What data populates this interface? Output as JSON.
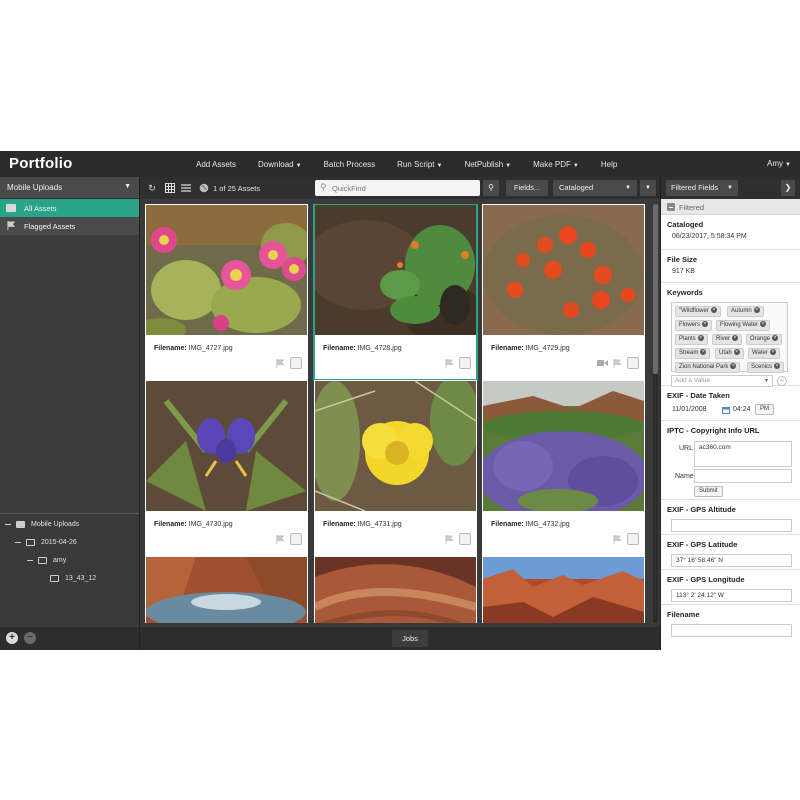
{
  "topbar": {
    "logo": "Portfolio",
    "nav": [
      {
        "label": "Add Assets",
        "caret": false
      },
      {
        "label": "Download",
        "caret": true
      },
      {
        "label": "Batch Process",
        "caret": false
      },
      {
        "label": "Run Script",
        "caret": true
      },
      {
        "label": "NetPublish",
        "caret": true
      },
      {
        "label": "Make PDF",
        "caret": true
      },
      {
        "label": "Help",
        "caret": false
      }
    ],
    "user": "Amy"
  },
  "left": {
    "dropdown": "Mobile Uploads",
    "items": [
      {
        "label": "All Assets",
        "selected": true
      },
      {
        "label": "Flagged Assets",
        "selected": false
      }
    ],
    "tree": [
      {
        "label": "Mobile Uploads"
      },
      {
        "label": "2015-04-26"
      },
      {
        "label": "amy"
      },
      {
        "label": "13_43_12"
      }
    ]
  },
  "toolbar": {
    "count": "1 of 25 Assets",
    "search_placeholder": "QuickFind",
    "fields_label": "Fields...",
    "sort_label": "Cataloged"
  },
  "grid": {
    "filename_label": "Filename:",
    "cards": [
      {
        "filename": "IMG_4727.jpg",
        "selected": false,
        "video": false,
        "image": "cactus-pink-flowers"
      },
      {
        "filename": "IMG_4728.jpg",
        "selected": true,
        "video": false,
        "image": "water-orange-flowers"
      },
      {
        "filename": "IMG_4729.jpg",
        "selected": false,
        "video": true,
        "image": "red-paintbrush-flowers"
      },
      {
        "filename": "IMG_4730.jpg",
        "selected": false,
        "video": false,
        "image": "purple-flower"
      },
      {
        "filename": "IMG_4731.jpg",
        "selected": false,
        "video": false,
        "image": "yellow-cactus-flower"
      },
      {
        "filename": "IMG_4732.jpg",
        "selected": false,
        "video": false,
        "image": "purple-lupine-field"
      },
      {
        "filename": "",
        "selected": false,
        "video": false,
        "image": "canyon-river"
      },
      {
        "filename": "",
        "selected": false,
        "video": false,
        "image": "slot-canyon"
      },
      {
        "filename": "",
        "selected": false,
        "video": false,
        "image": "red-canyon-vista"
      }
    ]
  },
  "footer": {
    "jobs_label": "Jobs"
  },
  "right": {
    "filter_dropdown": "Filtered Fields",
    "filtered_label": "Filtered",
    "cataloged": {
      "label": "Cataloged",
      "value": "06/23/2017, 5:58:34 PM"
    },
    "file_size": {
      "label": "File Size",
      "value": "917 KB"
    },
    "keywords": {
      "label": "Keywords",
      "items": [
        "Wildflower",
        "Autumn",
        "Flowers",
        "Flowing Water",
        "Plants",
        "River",
        "Orange",
        "Stream",
        "Utah",
        "Water",
        "Zion National Park",
        "Scenics"
      ],
      "add_placeholder": "Add a Value"
    },
    "exif_date": {
      "label": "EXIF - Date Taken",
      "date": "11/01/2008",
      "time": "04:24",
      "ampm": "PM"
    },
    "iptc": {
      "label": "IPTC - Copyright Info URL",
      "url_label": "URL",
      "url_value": "ac360.com",
      "name_label": "Name",
      "name_value": "",
      "submit_label": "Submit"
    },
    "gps_alt": {
      "label": "EXIF - GPS Altitude",
      "value": ""
    },
    "gps_lat": {
      "label": "EXIF - GPS Latitude",
      "value": "37° 16' 58.46\" N"
    },
    "gps_lon": {
      "label": "EXIF - GPS Longitude",
      "value": "113° 2' 24.12\" W"
    },
    "filename": {
      "label": "Filename"
    }
  },
  "colors": {
    "accent": "#2aa38b",
    "topbar": "#2b2b2b",
    "panel": "#3d3d3d"
  }
}
